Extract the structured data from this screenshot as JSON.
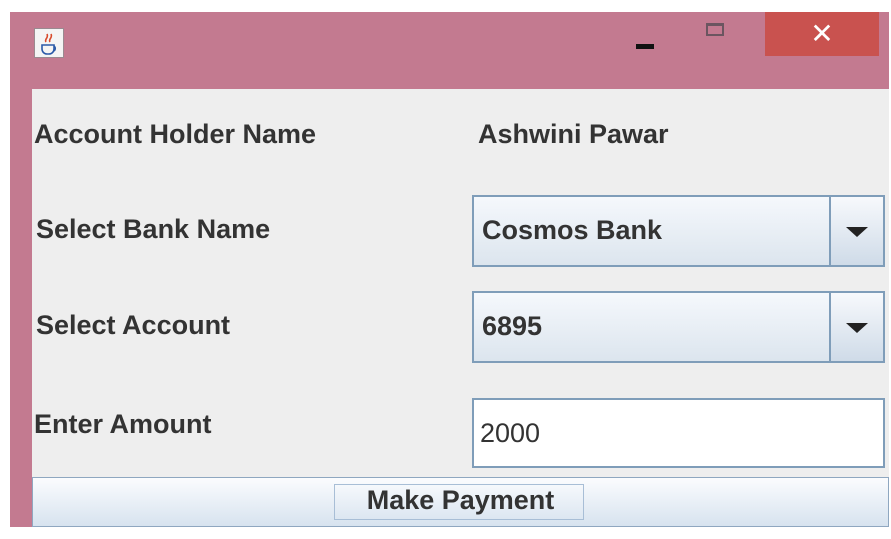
{
  "window": {
    "title": "",
    "icons": {
      "app": "java-cup-icon",
      "minimize": "minimize-icon",
      "maximize": "maximize-icon",
      "close": "close-icon"
    },
    "close_glyph": "✕"
  },
  "form": {
    "holder_label": "Account Holder Name",
    "holder_value": "Ashwini Pawar",
    "bank_label": "Select Bank Name",
    "bank_selected": "Cosmos Bank",
    "account_label": "Select Account",
    "account_selected": "6895",
    "amount_label": "Enter Amount",
    "amount_value": "2000",
    "pay_button": "Make Payment"
  },
  "colors": {
    "titlebar": "#c37a90",
    "close_button": "#c9524f",
    "panel": "#eeeeee",
    "border": "#7f9db9"
  }
}
